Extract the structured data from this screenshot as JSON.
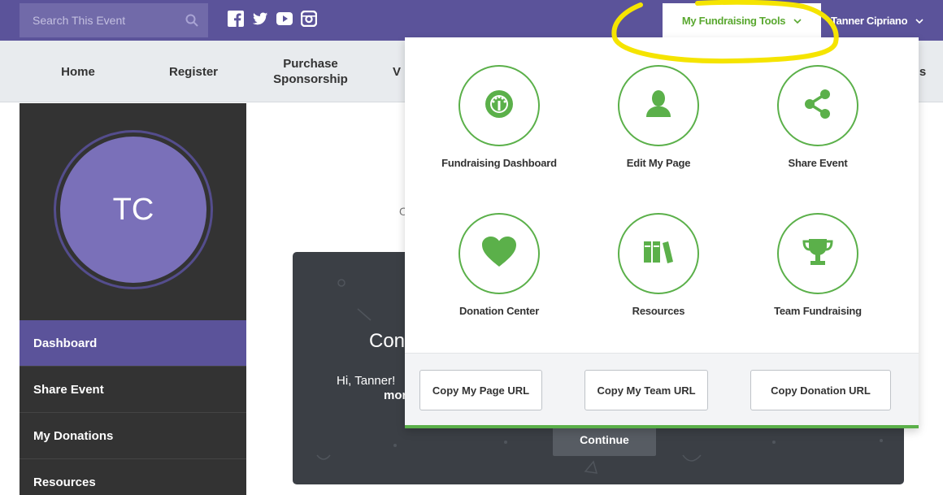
{
  "search": {
    "placeholder": "Search This Event"
  },
  "topbar": {
    "social_icons": [
      "facebook-icon",
      "twitter-icon",
      "youtube-icon",
      "instagram-icon"
    ],
    "tools_label": "My Fundraising Tools",
    "user_name": "Tanner Cipriano"
  },
  "nav": {
    "items": [
      {
        "label": "Home"
      },
      {
        "label": "Register"
      },
      {
        "label": "Purchase\nSponsorship"
      },
      {
        "label": "V"
      },
      {
        "label": "s"
      }
    ]
  },
  "sidebar": {
    "initials": "TC",
    "items": [
      {
        "label": "Dashboard",
        "active": true
      },
      {
        "label": "Share Event"
      },
      {
        "label": "My Donations"
      },
      {
        "label": "Resources"
      }
    ]
  },
  "main": {
    "partial_letter": "O",
    "card": {
      "title_partial": "Con",
      "text_partial": "Hi, Tanner!",
      "bold_partial": "more",
      "continue_label": "Continue"
    }
  },
  "dropdown": {
    "tools": [
      {
        "label": "Fundraising Dashboard",
        "icon": "gauge-icon"
      },
      {
        "label": "Edit My Page",
        "icon": "person-icon"
      },
      {
        "label": "Share Event",
        "icon": "share-icon"
      },
      {
        "label": "Donation Center",
        "icon": "heart-icon"
      },
      {
        "label": "Resources",
        "icon": "books-icon"
      },
      {
        "label": "Team Fundraising",
        "icon": "trophy-icon"
      }
    ],
    "copy_buttons": [
      {
        "label": "Copy My Page URL"
      },
      {
        "label": "Copy My Team URL"
      },
      {
        "label": "Copy Donation URL"
      }
    ]
  },
  "colors": {
    "brand_purple": "#5b539a",
    "accent_green": "#5bb04a",
    "highlight_yellow": "#f5e400",
    "sidebar_dark": "#333333"
  }
}
